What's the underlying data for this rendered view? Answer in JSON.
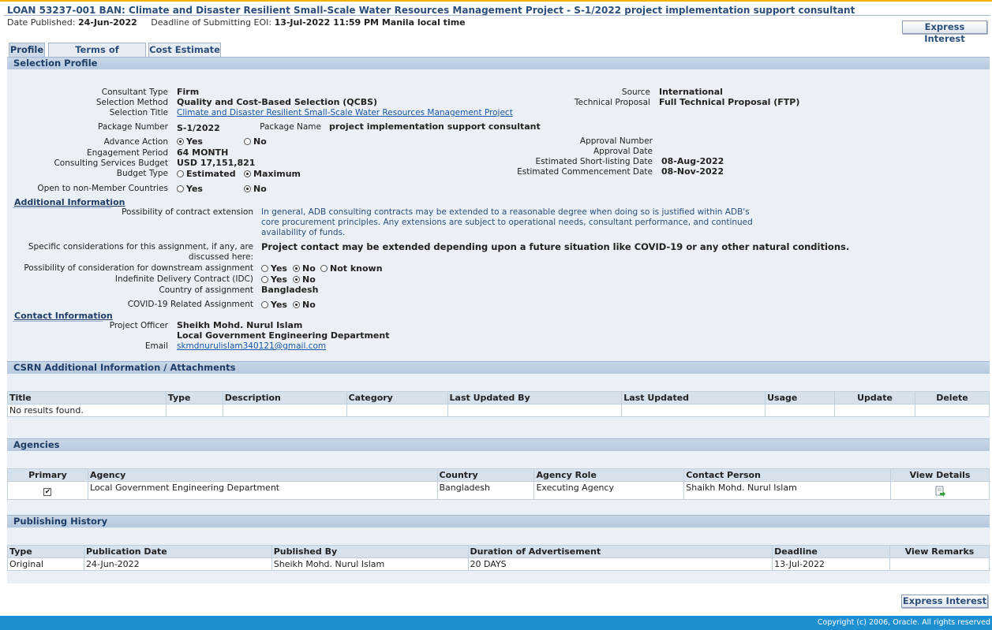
{
  "header": {
    "title": "LOAN 53237-001 BAN: Climate and Disaster Resilient Small-Scale Water Resources Management Project - S-1/2022 project implementation support consultant",
    "date_published_label": "Date Published:",
    "date_published": "24-Jun-2022",
    "deadline_label": "Deadline of Submitting EOI:",
    "deadline": "13-Jul-2022 11:59 PM Manila local time"
  },
  "buttons": {
    "express_interest": "Express Interest"
  },
  "tabs": [
    {
      "label": "Profile",
      "active": true
    },
    {
      "label": "Terms of Reference"
    },
    {
      "label": "Cost Estimate"
    }
  ],
  "selection_profile": {
    "heading": "Selection Profile",
    "consultant_type_label": "Consultant Type",
    "consultant_type": "Firm",
    "selection_method_label": "Selection Method",
    "selection_method": "Quality and Cost-Based Selection (QCBS)",
    "selection_title_label": "Selection Title",
    "selection_title": "Climate and Disaster Resilient Small-Scale Water Resources Management Project",
    "package_number_label": "Package Number",
    "package_number": "S-1/2022",
    "package_name_label": "Package Name",
    "package_name": "project implementation support consultant",
    "advance_action_label": "Advance Action",
    "yes": "Yes",
    "no": "No",
    "not_known": "Not known",
    "engagement_period_label": "Engagement Period",
    "engagement_period": "64 MONTH",
    "budget_label": "Consulting Services Budget",
    "budget": "USD 17,151,821",
    "budget_type_label": "Budget Type",
    "estimated": "Estimated",
    "maximum": "Maximum",
    "non_member_label": "Open to non-Member Countries",
    "source_label": "Source",
    "source": "International",
    "technical_proposal_label": "Technical Proposal",
    "technical_proposal": "Full Technical Proposal (FTP)",
    "approval_number_label": "Approval Number",
    "approval_date_label": "Approval Date",
    "shortlisting_label": "Estimated Short-listing Date",
    "shortlisting": "08-Aug-2022",
    "commencement_label": "Estimated Commencement Date",
    "commencement": "08-Nov-2022"
  },
  "additional_info": {
    "heading": "Additional Information",
    "extension_label": "Possibility of contract extension",
    "extension_text": "In general, ADB consulting contracts may be extended to a reasonable degree when doing so is justified within ADB's core procurement principles. Any extensions are subject to operational needs, consultant performance, and continued availability of funds.",
    "specific_label_1": "Specific considerations for this assignment, if any, are",
    "specific_label_2": "discussed here:",
    "specific_text": "Project contact may be extended depending upon a future situation like COVID-19 or any other natural conditions.",
    "downstream_label": "Possibility of consideration for downstream assignment",
    "idc_label": "Indefinite Delivery Contract (IDC)",
    "country_label": "Country of assignment",
    "country": "Bangladesh",
    "covid_label": "COVID-19 Related Assignment"
  },
  "contact_info": {
    "heading": "Contact Information",
    "officer_label": "Project Officer",
    "officer_name": "Sheikh Mohd. Nurul Islam",
    "officer_dept": "Local Government Engineering Department",
    "email_label": "Email",
    "email": "skmdnurulislam340121@gmail.com"
  },
  "csrn": {
    "heading": "CSRN Additional Information / Attachments",
    "columns": [
      "Title",
      "Type",
      "Description",
      "Category",
      "Last Updated By",
      "Last Updated",
      "Usage",
      "Update",
      "Delete"
    ],
    "empty": "No results found."
  },
  "agencies": {
    "heading": "Agencies",
    "columns": [
      "Primary",
      "Agency",
      "Country",
      "Agency Role",
      "Contact Person",
      "View Details"
    ],
    "rows": [
      {
        "agency": "Local Government Engineering Department",
        "country": "Bangladesh",
        "role": "Executing Agency",
        "contact": "Shaikh Mohd. Nurul Islam",
        "primary_mark": "✔"
      }
    ]
  },
  "publishing": {
    "heading": "Publishing History",
    "columns": [
      "Type",
      "Publication Date",
      "Published By",
      "Duration of Advertisement",
      "Deadline",
      "View Remarks"
    ],
    "rows": [
      {
        "type": "Original",
        "date": "24-Jun-2022",
        "by": "Sheikh Mohd. Nurul Islam",
        "duration": "20 DAYS",
        "deadline": "13-Jul-2022"
      }
    ]
  },
  "footer": {
    "copyright": "Copyright (c) 2006, Oracle. All rights reserved"
  }
}
